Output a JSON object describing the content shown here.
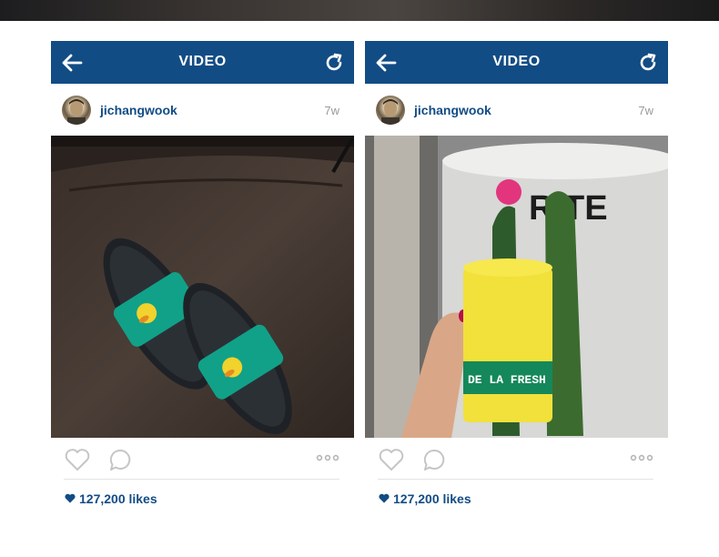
{
  "colors": {
    "header_bg": "#124c85",
    "accent_text": "#124c85",
    "meta_text": "#9a9a9a"
  },
  "posts": [
    {
      "header_title": "VIDEO",
      "back_icon": "arrow-left-icon",
      "refresh_icon": "refresh-icon",
      "username": "jichangwook",
      "time": "7w",
      "photo": "black slide sandals with teal strap and yellow duck character on leather surface",
      "likes": "127,200 likes"
    },
    {
      "header_title": "VIDEO",
      "back_icon": "arrow-left-icon",
      "refresh_icon": "refresh-icon",
      "username": "jichangwook",
      "time": "7w",
      "photo": "hand holding yellow can with green band, cactus with pink flower",
      "can_label": "DE LA FRESH",
      "bucket_label": "RITE",
      "likes": "127,200 likes"
    }
  ]
}
